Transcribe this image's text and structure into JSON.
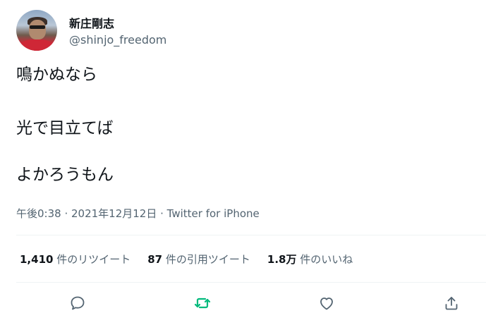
{
  "user": {
    "display_name": "新庄剛志",
    "handle": "@shinjo_freedom"
  },
  "tweet": {
    "lines": [
      "鳴かぬなら",
      "光で目立てば",
      "よかろうもん"
    ]
  },
  "meta": {
    "time": "午後0:38",
    "separator1": " · ",
    "date": "2021年12月12日",
    "separator2": " · ",
    "source": "Twitter for iPhone"
  },
  "stats": {
    "retweets_count": "1,410",
    "retweets_label": "件のリツイート",
    "quotes_count": "87",
    "quotes_label": "件の引用ツイート",
    "likes_count": "1.8万",
    "likes_label": "件のいいね"
  },
  "actions": {
    "icons": [
      "reply-icon",
      "retweet-icon",
      "like-icon",
      "share-icon"
    ],
    "retweet_color": "#00ba7c",
    "icon_color": "#536471"
  }
}
